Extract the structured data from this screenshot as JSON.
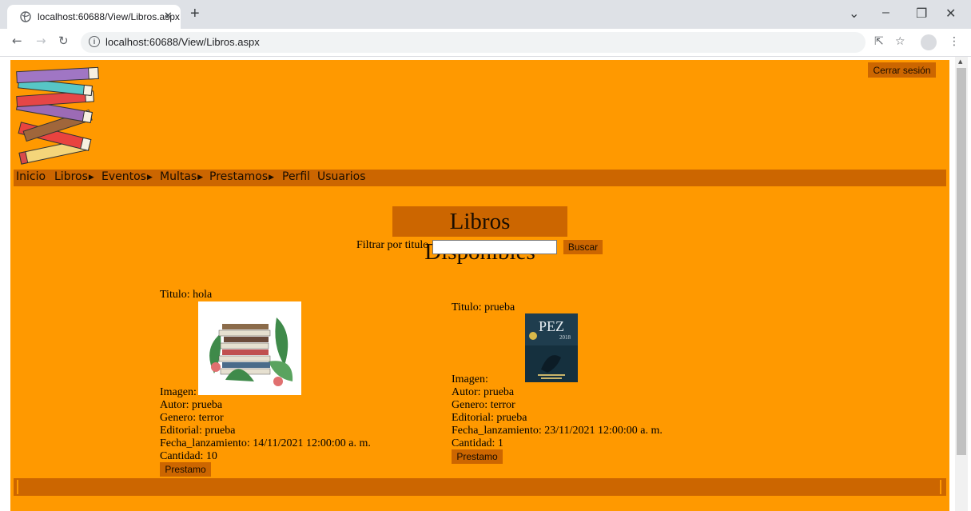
{
  "browser": {
    "tab_title": "localhost:60688/View/Libros.aspx",
    "tab_close": "✕",
    "new_tab": "+",
    "url": "localhost:60688/View/Libros.aspx",
    "window_controls": {
      "tab_search": "⌄",
      "minimize": "–",
      "restore": "❐",
      "close": "✕"
    }
  },
  "header": {
    "logout_label": "Cerrar sesión"
  },
  "menu": {
    "items": [
      {
        "label": "Inicio",
        "has_submenu": false
      },
      {
        "label": "Libros",
        "has_submenu": true
      },
      {
        "label": "Eventos",
        "has_submenu": true
      },
      {
        "label": "Multas",
        "has_submenu": true
      },
      {
        "label": "Prestamos",
        "has_submenu": true
      },
      {
        "label": "Perfil",
        "has_submenu": false
      },
      {
        "label": "Usuarios",
        "has_submenu": false
      }
    ],
    "submenu_arrow": "▶"
  },
  "main": {
    "title": "Libros Disponibles",
    "filter_label": "Filtrar por titulo",
    "filter_value": "",
    "search_label": "Buscar"
  },
  "books": [
    {
      "titulo": "Titulo: hola",
      "imagen": "Imagen:",
      "autor": "Autor: prueba",
      "genero": "Genero: terror",
      "editorial": "Editorial: prueba",
      "fecha": "Fecha_lanzamiento: 14/11/2021 12:00:00 a. m.",
      "cantidad": "Cantidad: 10",
      "loan_label": "Prestamo"
    },
    {
      "titulo": "Titulo: prueba",
      "imagen": "Imagen:",
      "autor": "Autor: prueba",
      "genero": "Genero: terror",
      "editorial": "Editorial: prueba",
      "fecha": "Fecha_lanzamiento: 23/11/2021 12:00:00 a. m.",
      "cantidad": "Cantidad: 1",
      "loan_label": "Prestamo",
      "cover_text": "PEZ",
      "cover_subtext": "2018"
    }
  ],
  "colors": {
    "page_background": "#ff9900",
    "accent": "#cc6600"
  }
}
